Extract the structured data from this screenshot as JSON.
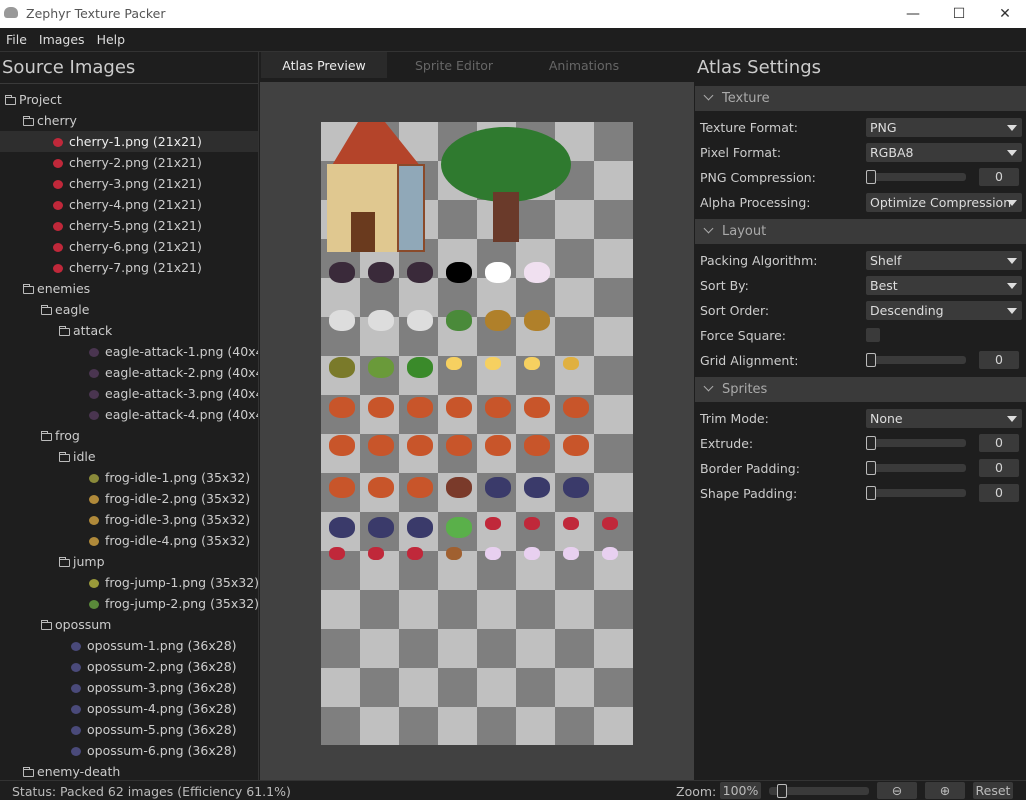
{
  "window": {
    "title": "Zephyr Texture Packer",
    "minimize": "—",
    "maximize": "☐",
    "close": "✕"
  },
  "menu": [
    "File",
    "Images",
    "Help"
  ],
  "left": {
    "title": "Source Images",
    "tree": [
      {
        "label": "Project",
        "type": "folder",
        "depth": 0
      },
      {
        "label": "cherry",
        "type": "folder",
        "depth": 1
      },
      {
        "label": "cherry-1.png (21x21)",
        "type": "file",
        "depth": 2,
        "selected": true,
        "color": "#c0283a"
      },
      {
        "label": "cherry-2.png (21x21)",
        "type": "file",
        "depth": 2,
        "color": "#c0283a"
      },
      {
        "label": "cherry-3.png (21x21)",
        "type": "file",
        "depth": 2,
        "color": "#c0283a"
      },
      {
        "label": "cherry-4.png (21x21)",
        "type": "file",
        "depth": 2,
        "color": "#c0283a"
      },
      {
        "label": "cherry-5.png (21x21)",
        "type": "file",
        "depth": 2,
        "color": "#c0283a"
      },
      {
        "label": "cherry-6.png (21x21)",
        "type": "file",
        "depth": 2,
        "color": "#c0283a"
      },
      {
        "label": "cherry-7.png (21x21)",
        "type": "file",
        "depth": 2,
        "color": "#c0283a"
      },
      {
        "label": "enemies",
        "type": "folder",
        "depth": 1
      },
      {
        "label": "eagle",
        "type": "folder",
        "depth": 2
      },
      {
        "label": "attack",
        "type": "folder",
        "depth": 3
      },
      {
        "label": "eagle-attack-1.png (40x41)",
        "type": "file",
        "depth": 4,
        "color": "#4a3550"
      },
      {
        "label": "eagle-attack-2.png (40x41)",
        "type": "file",
        "depth": 4,
        "color": "#4a3550"
      },
      {
        "label": "eagle-attack-3.png (40x41)",
        "type": "file",
        "depth": 4,
        "color": "#4a3550"
      },
      {
        "label": "eagle-attack-4.png (40x41)",
        "type": "file",
        "depth": 4,
        "color": "#4a3550"
      },
      {
        "label": "frog",
        "type": "folder",
        "depth": 2
      },
      {
        "label": "idle",
        "type": "folder",
        "depth": 3
      },
      {
        "label": "frog-idle-1.png (35x32)",
        "type": "file",
        "depth": 4,
        "color": "#8a8a3a"
      },
      {
        "label": "frog-idle-2.png (35x32)",
        "type": "file",
        "depth": 4,
        "color": "#b08a3a"
      },
      {
        "label": "frog-idle-3.png (35x32)",
        "type": "file",
        "depth": 4,
        "color": "#b08a3a"
      },
      {
        "label": "frog-idle-4.png (35x32)",
        "type": "file",
        "depth": 4,
        "color": "#b08a3a"
      },
      {
        "label": "jump",
        "type": "folder",
        "depth": 3
      },
      {
        "label": "frog-jump-1.png (35x32)",
        "type": "file",
        "depth": 4,
        "color": "#9a9a3a"
      },
      {
        "label": "frog-jump-2.png (35x32)",
        "type": "file",
        "depth": 4,
        "color": "#5a8a3a"
      },
      {
        "label": "opossum",
        "type": "folder",
        "depth": 2
      },
      {
        "label": "opossum-1.png (36x28)",
        "type": "file",
        "depth": 3,
        "color": "#4a4a7a"
      },
      {
        "label": "opossum-2.png (36x28)",
        "type": "file",
        "depth": 3,
        "color": "#4a4a7a"
      },
      {
        "label": "opossum-3.png (36x28)",
        "type": "file",
        "depth": 3,
        "color": "#4a4a7a"
      },
      {
        "label": "opossum-4.png (36x28)",
        "type": "file",
        "depth": 3,
        "color": "#4a4a7a"
      },
      {
        "label": "opossum-5.png (36x28)",
        "type": "file",
        "depth": 3,
        "color": "#4a4a7a"
      },
      {
        "label": "opossum-6.png (36x28)",
        "type": "file",
        "depth": 3,
        "color": "#4a4a7a"
      },
      {
        "label": "enemy-death",
        "type": "folder",
        "depth": 1
      }
    ]
  },
  "tabs": [
    {
      "label": "Atlas Preview",
      "active": true
    },
    {
      "label": "Sprite Editor"
    },
    {
      "label": "Animations"
    }
  ],
  "settings": {
    "title": "Atlas Settings",
    "texture": {
      "header": "Texture",
      "texture_format_label": "Texture Format:",
      "texture_format": "PNG",
      "pixel_format_label": "Pixel Format:",
      "pixel_format": "RGBA8",
      "png_compression_label": "PNG Compression:",
      "png_compression": "0",
      "alpha_label": "Alpha Processing:",
      "alpha": "Optimize Compression"
    },
    "layout": {
      "header": "Layout",
      "packing_label": "Packing Algorithm:",
      "packing": "Shelf",
      "sort_by_label": "Sort By:",
      "sort_by": "Best",
      "sort_order_label": "Sort Order:",
      "sort_order": "Descending",
      "force_square_label": "Force Square:",
      "force_square": false,
      "grid_label": "Grid Alignment:",
      "grid": "0"
    },
    "sprites": {
      "header": "Sprites",
      "trim_label": "Trim Mode:",
      "trim": "None",
      "extrude_label": "Extrude:",
      "extrude": "0",
      "border_label": "Border Padding:",
      "border": "0",
      "shape_label": "Shape Padding:",
      "shape": "0"
    }
  },
  "status": {
    "text": "Status:  Packed 62 images (Efficiency 61.1%)",
    "zoom_label": "Zoom:",
    "zoom": "100%",
    "zoom_out": "⊖",
    "zoom_in": "⊕",
    "reset": "Reset"
  }
}
